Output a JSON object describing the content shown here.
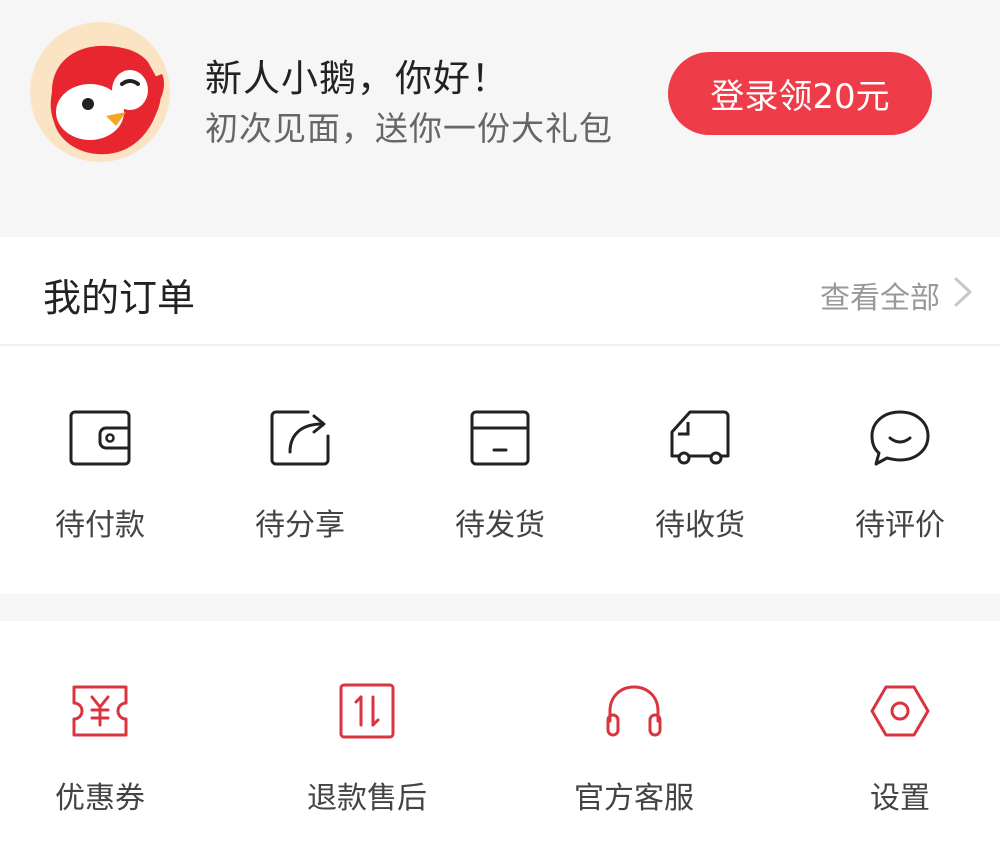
{
  "header": {
    "greeting": "新人小鹅，你好！",
    "subgreeting": "初次见面，送你一份大礼包",
    "login_button": "登录领20元",
    "avatar_icon": "penguin-mascot-icon",
    "accent_color": "#ee3c48"
  },
  "orders": {
    "title": "我的订单",
    "view_all": "查看全部",
    "items": [
      {
        "label": "待付款",
        "icon": "wallet-icon"
      },
      {
        "label": "待分享",
        "icon": "share-icon"
      },
      {
        "label": "待发货",
        "icon": "package-box-icon"
      },
      {
        "label": "待收货",
        "icon": "delivery-truck-icon"
      },
      {
        "label": "待评价",
        "icon": "comment-bubble-icon"
      }
    ]
  },
  "tools": {
    "items": [
      {
        "label": "优惠券",
        "icon": "coupon-icon"
      },
      {
        "label": "退款售后",
        "icon": "refund-icon"
      },
      {
        "label": "官方客服",
        "icon": "headphones-icon"
      },
      {
        "label": "设置",
        "icon": "settings-hexagon-icon"
      }
    ]
  }
}
